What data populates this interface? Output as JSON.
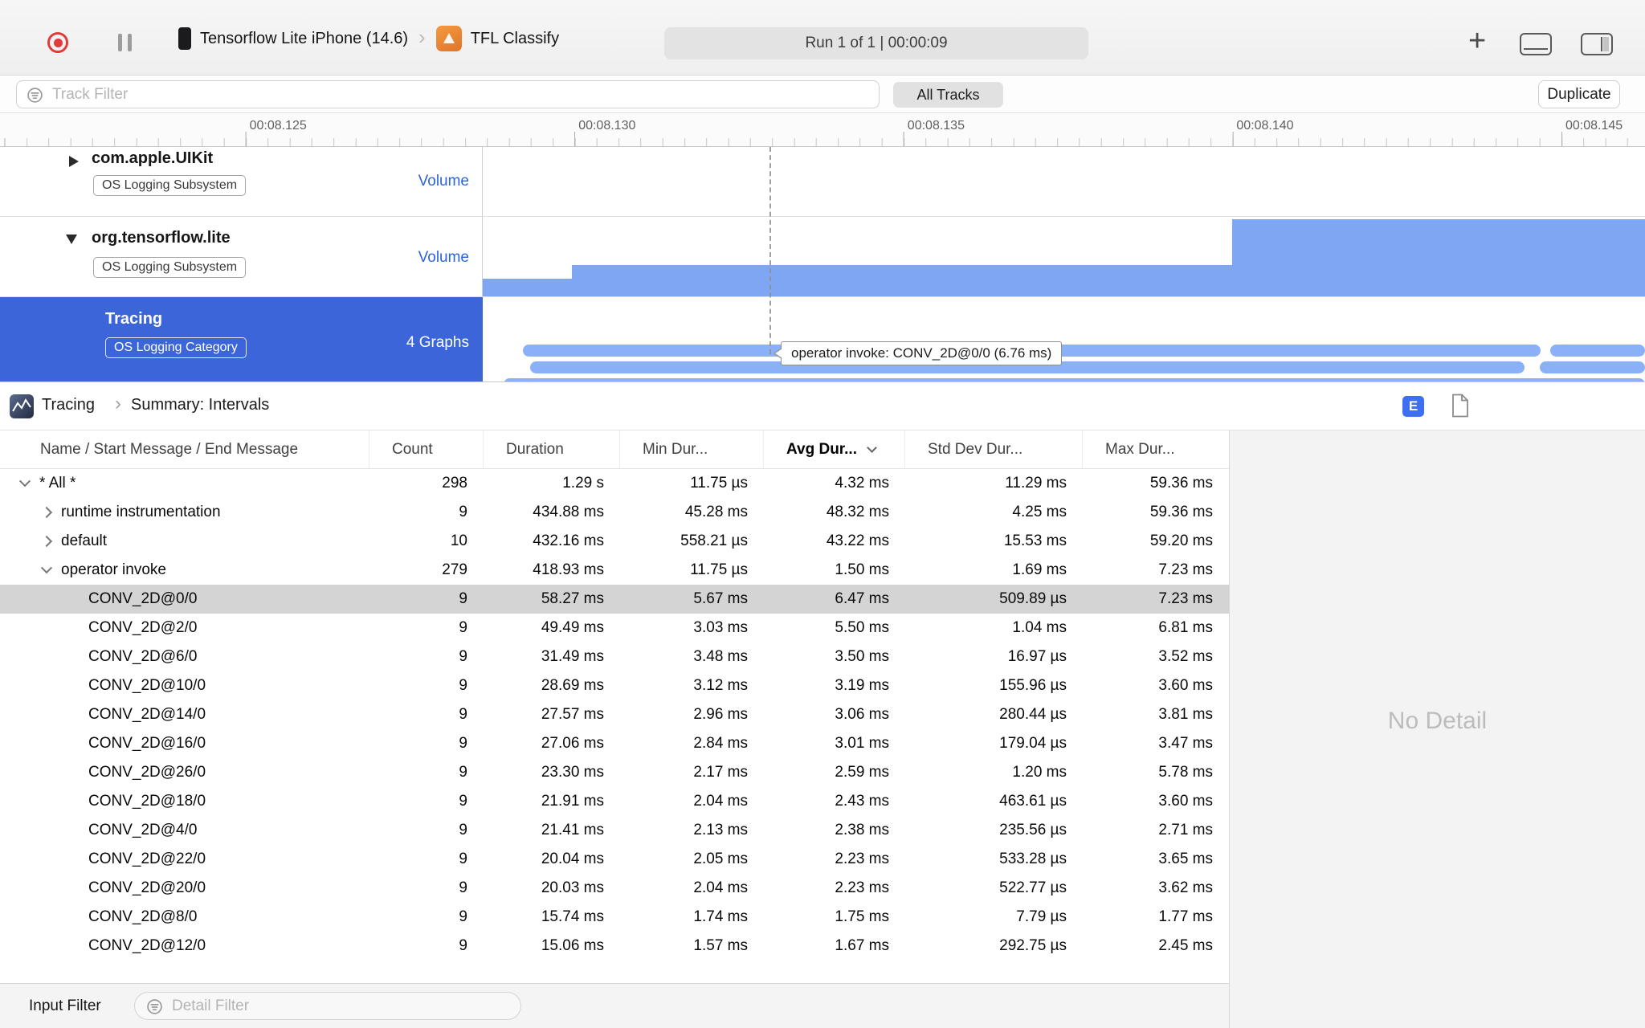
{
  "toolbar": {
    "device_name": "Tensorflow Lite iPhone (14.6)",
    "app_name": "TFL Classify",
    "run_status": "Run 1 of 1   |   00:00:09"
  },
  "filter_bar": {
    "track_filter_placeholder": "Track Filter",
    "all_tracks_label": "All Tracks",
    "duplicate_label": "Duplicate"
  },
  "ruler": {
    "labels": [
      "00:08.125",
      "00:08.130",
      "00:08.135",
      "00:08.140",
      "00:08.145"
    ]
  },
  "tracks": [
    {
      "title": "com.apple.UIKit",
      "badge": "OS Logging Subsystem",
      "meta": "Volume",
      "disclosure": "collapsed"
    },
    {
      "title": "org.tensorflow.lite",
      "badge": "OS Logging Subsystem",
      "meta": "Volume",
      "disclosure": "expanded"
    },
    {
      "title": "Tracing",
      "badge": "OS Logging Category",
      "meta": "4 Graphs",
      "selected": true
    }
  ],
  "timeline": {
    "tooltip": "operator invoke: CONV_2D@0/0 (6.76 ms)"
  },
  "detail_panel": {
    "breadcrumb_root": "Tracing",
    "breadcrumb_page": "Summary: Intervals",
    "extended_detail_badge": "E",
    "no_detail": "No Detail"
  },
  "table": {
    "columns": [
      "Name / Start Message / End Message",
      "Count",
      "Duration",
      "Min Dur...",
      "Avg Dur...",
      "Std Dev Dur...",
      "Max Dur..."
    ],
    "rows": [
      {
        "name": "* All *",
        "level": 0,
        "disclosure": "expanded",
        "count": "298",
        "duration": "1.29 s",
        "min": "11.75 µs",
        "avg": "4.32 ms",
        "std": "11.29 ms",
        "max": "59.36 ms"
      },
      {
        "name": "runtime instrumentation",
        "level": 1,
        "disclosure": "collapsed",
        "count": "9",
        "duration": "434.88 ms",
        "min": "45.28 ms",
        "avg": "48.32 ms",
        "std": "4.25 ms",
        "max": "59.36 ms"
      },
      {
        "name": "default",
        "level": 1,
        "disclosure": "collapsed",
        "count": "10",
        "duration": "432.16 ms",
        "min": "558.21 µs",
        "avg": "43.22 ms",
        "std": "15.53 ms",
        "max": "59.20 ms"
      },
      {
        "name": "operator invoke",
        "level": 1,
        "disclosure": "expanded",
        "count": "279",
        "duration": "418.93 ms",
        "min": "11.75 µs",
        "avg": "1.50 ms",
        "std": "1.69 ms",
        "max": "7.23 ms"
      },
      {
        "name": "CONV_2D@0/0",
        "level": 2,
        "selected": true,
        "count": "9",
        "duration": "58.27 ms",
        "min": "5.67 ms",
        "avg": "6.47 ms",
        "std": "509.89 µs",
        "max": "7.23 ms"
      },
      {
        "name": "CONV_2D@2/0",
        "level": 2,
        "count": "9",
        "duration": "49.49 ms",
        "min": "3.03 ms",
        "avg": "5.50 ms",
        "std": "1.04 ms",
        "max": "6.81 ms"
      },
      {
        "name": "CONV_2D@6/0",
        "level": 2,
        "count": "9",
        "duration": "31.49 ms",
        "min": "3.48 ms",
        "avg": "3.50 ms",
        "std": "16.97 µs",
        "max": "3.52 ms"
      },
      {
        "name": "CONV_2D@10/0",
        "level": 2,
        "count": "9",
        "duration": "28.69 ms",
        "min": "3.12 ms",
        "avg": "3.19 ms",
        "std": "155.96 µs",
        "max": "3.60 ms"
      },
      {
        "name": "CONV_2D@14/0",
        "level": 2,
        "count": "9",
        "duration": "27.57 ms",
        "min": "2.96 ms",
        "avg": "3.06 ms",
        "std": "280.44 µs",
        "max": "3.81 ms"
      },
      {
        "name": "CONV_2D@16/0",
        "level": 2,
        "count": "9",
        "duration": "27.06 ms",
        "min": "2.84 ms",
        "avg": "3.01 ms",
        "std": "179.04 µs",
        "max": "3.47 ms"
      },
      {
        "name": "CONV_2D@26/0",
        "level": 2,
        "count": "9",
        "duration": "23.30 ms",
        "min": "2.17 ms",
        "avg": "2.59 ms",
        "std": "1.20 ms",
        "max": "5.78 ms"
      },
      {
        "name": "CONV_2D@18/0",
        "level": 2,
        "count": "9",
        "duration": "21.91 ms",
        "min": "2.04 ms",
        "avg": "2.43 ms",
        "std": "463.61 µs",
        "max": "3.60 ms"
      },
      {
        "name": "CONV_2D@4/0",
        "level": 2,
        "count": "9",
        "duration": "21.41 ms",
        "min": "2.13 ms",
        "avg": "2.38 ms",
        "std": "235.56 µs",
        "max": "2.71 ms"
      },
      {
        "name": "CONV_2D@22/0",
        "level": 2,
        "count": "9",
        "duration": "20.04 ms",
        "min": "2.05 ms",
        "avg": "2.23 ms",
        "std": "533.28 µs",
        "max": "3.65 ms"
      },
      {
        "name": "CONV_2D@20/0",
        "level": 2,
        "count": "9",
        "duration": "20.03 ms",
        "min": "2.04 ms",
        "avg": "2.23 ms",
        "std": "522.77 µs",
        "max": "3.62 ms"
      },
      {
        "name": "CONV_2D@8/0",
        "level": 2,
        "count": "9",
        "duration": "15.74 ms",
        "min": "1.74 ms",
        "avg": "1.75 ms",
        "std": "7.79 µs",
        "max": "1.77 ms"
      },
      {
        "name": "CONV_2D@12/0",
        "level": 2,
        "count": "9",
        "duration": "15.06 ms",
        "min": "1.57 ms",
        "avg": "1.67 ms",
        "std": "292.75 µs",
        "max": "2.45 ms"
      }
    ]
  },
  "bottom_bar": {
    "input_filter_label": "Input Filter",
    "detail_filter_placeholder": "Detail Filter"
  }
}
